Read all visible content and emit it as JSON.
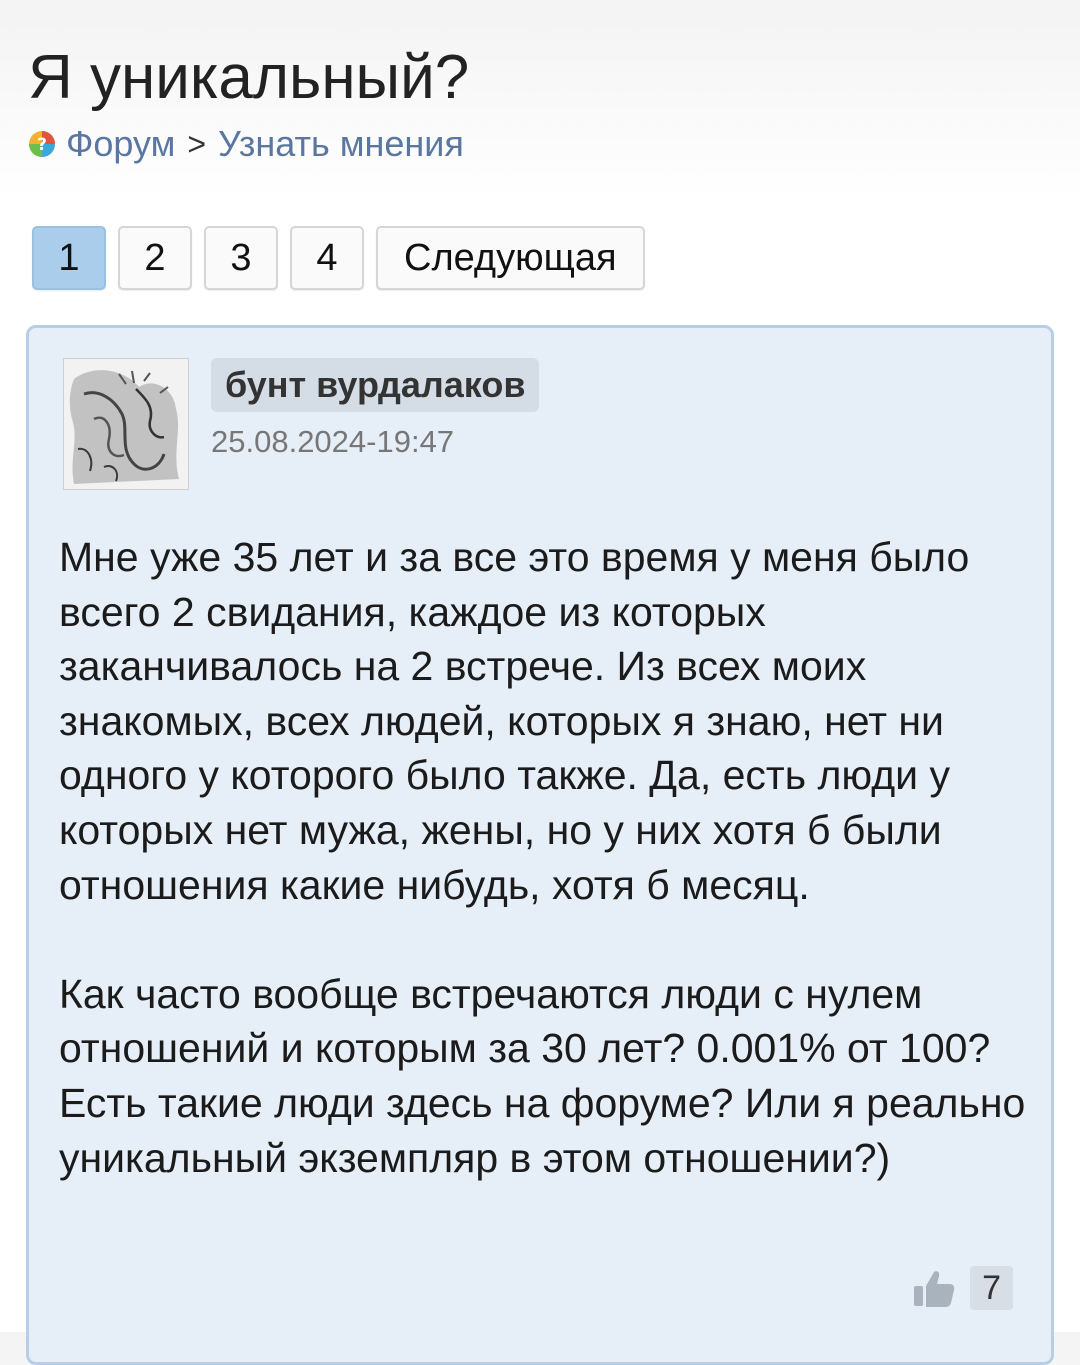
{
  "page": {
    "title": "Я уникальный?"
  },
  "breadcrumb": {
    "icon": "forum-logo-icon",
    "forum": "Форум",
    "separator": ">",
    "section": "Узнать мнения"
  },
  "pagination": {
    "pages": [
      "1",
      "2",
      "3",
      "4"
    ],
    "active_page": "1",
    "next_label": "Следующая"
  },
  "post": {
    "author": "бунт вурдалаков",
    "date": "25.08.2024-19:47",
    "paragraphs": [
      "Мне уже 35 лет и за все это время у меня было всего 2 свидания, каждое из которых заканчивалось на 2 встрече. Из всех моих знакомых, всех людей, которых я знаю, нет ни одного у которого было также. Да, есть люди у которых нет мужа, жены, но у них хотя б были отношения какие нибудь, хотя б месяц.",
      "Как часто вообще встречаются люди с нулем отношений и которым за 30 лет? 0.001% от 100? Есть такие люди здесь на форуме? Или я реально уникальный экземпляр в этом отношении?)"
    ],
    "likes": "7",
    "like_icon": "thumbs-up-icon"
  },
  "colors": {
    "link": "#5a77a1",
    "card_background": "#e6eef8",
    "card_border": "#b7cfe6",
    "active_page": "#a9cdea"
  }
}
